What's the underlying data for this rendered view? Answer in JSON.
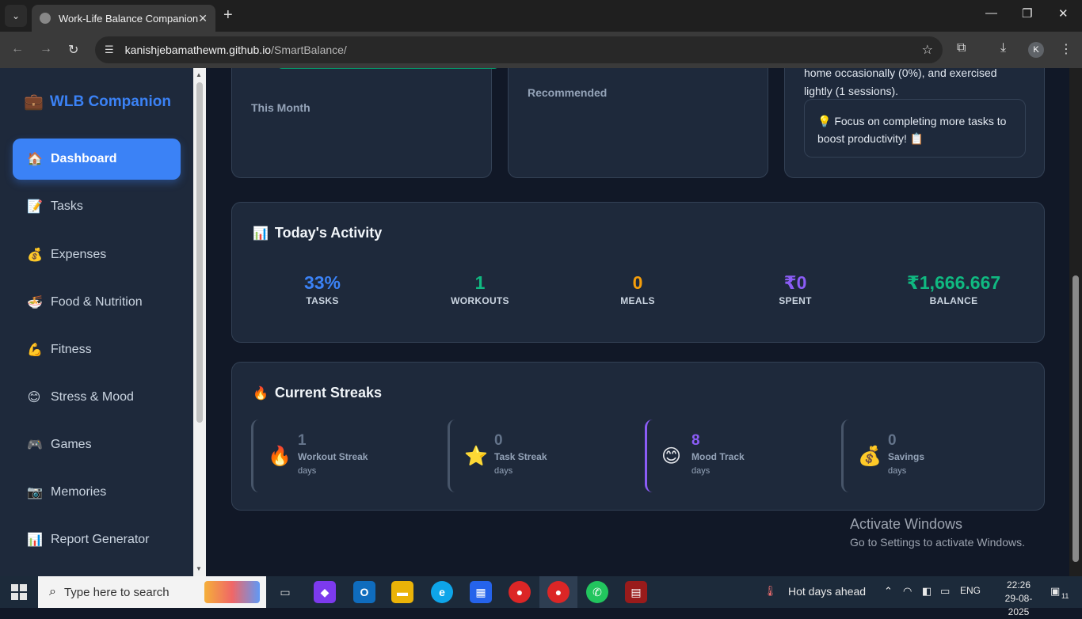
{
  "browser": {
    "tab_title": "Work-Life Balance Companion",
    "url_host": "kanishjebamathewm.github.io",
    "url_path": "/SmartBalance/",
    "profile_initial": "K"
  },
  "sidebar": {
    "brand": "WLB Companion",
    "items": [
      {
        "label": "Dashboard",
        "icon": "house-icon",
        "glyph": "🏠"
      },
      {
        "label": "Tasks",
        "icon": "memo-icon",
        "glyph": "📝"
      },
      {
        "label": "Expenses",
        "icon": "money-bag-icon",
        "glyph": "💰"
      },
      {
        "label": "Food & Nutrition",
        "icon": "bowl-icon",
        "glyph": "🍜"
      },
      {
        "label": "Fitness",
        "icon": "biceps-icon",
        "glyph": "💪"
      },
      {
        "label": "Stress & Mood",
        "icon": "smiley-icon",
        "glyph": "😊"
      },
      {
        "label": "Games",
        "icon": "gamepad-icon",
        "glyph": "🎮"
      },
      {
        "label": "Memories",
        "icon": "camera-icon",
        "glyph": "📷"
      },
      {
        "label": "Report Generator",
        "icon": "bar-chart-icon",
        "glyph": "📊"
      }
    ]
  },
  "top_cards": {
    "budget_sub": "This Month",
    "recommended_sub": "Recommended",
    "insight_text": "home occasionally (0%), and exercised lightly (1 sessions).",
    "tip": "💡 Focus on completing more tasks to boost productivity! 📋"
  },
  "activity": {
    "title": "Today's Activity",
    "stats": [
      {
        "value": "33%",
        "label": "TASKS",
        "color": "#3b82f6"
      },
      {
        "value": "1",
        "label": "WORKOUTS",
        "color": "#10b981"
      },
      {
        "value": "0",
        "label": "MEALS",
        "color": "#f59e0b"
      },
      {
        "value": "₹0",
        "label": "SPENT",
        "color": "#8b5cf6"
      },
      {
        "value": "₹1,666.667",
        "label": "BALANCE",
        "color": "#10b981"
      }
    ]
  },
  "streaks": {
    "title": "Current Streaks",
    "items": [
      {
        "num": "1",
        "name": "Workout Streak",
        "unit": "days",
        "glyph": "🔥"
      },
      {
        "num": "0",
        "name": "Task Streak",
        "unit": "days",
        "glyph": "⭐"
      },
      {
        "num": "8",
        "name": "Mood Track",
        "unit": "days",
        "glyph": "😊"
      },
      {
        "num": "0",
        "name": "Savings",
        "unit": "days",
        "glyph": "💰"
      }
    ]
  },
  "watermark": {
    "line1": "Activate Windows",
    "line2": "Go to Settings to activate Windows."
  },
  "taskbar": {
    "search_placeholder": "Type here to search",
    "weather": "Hot days ahead",
    "lang": "ENG",
    "time": "22:26",
    "date": "29-08-2025",
    "notif_count": "11"
  }
}
